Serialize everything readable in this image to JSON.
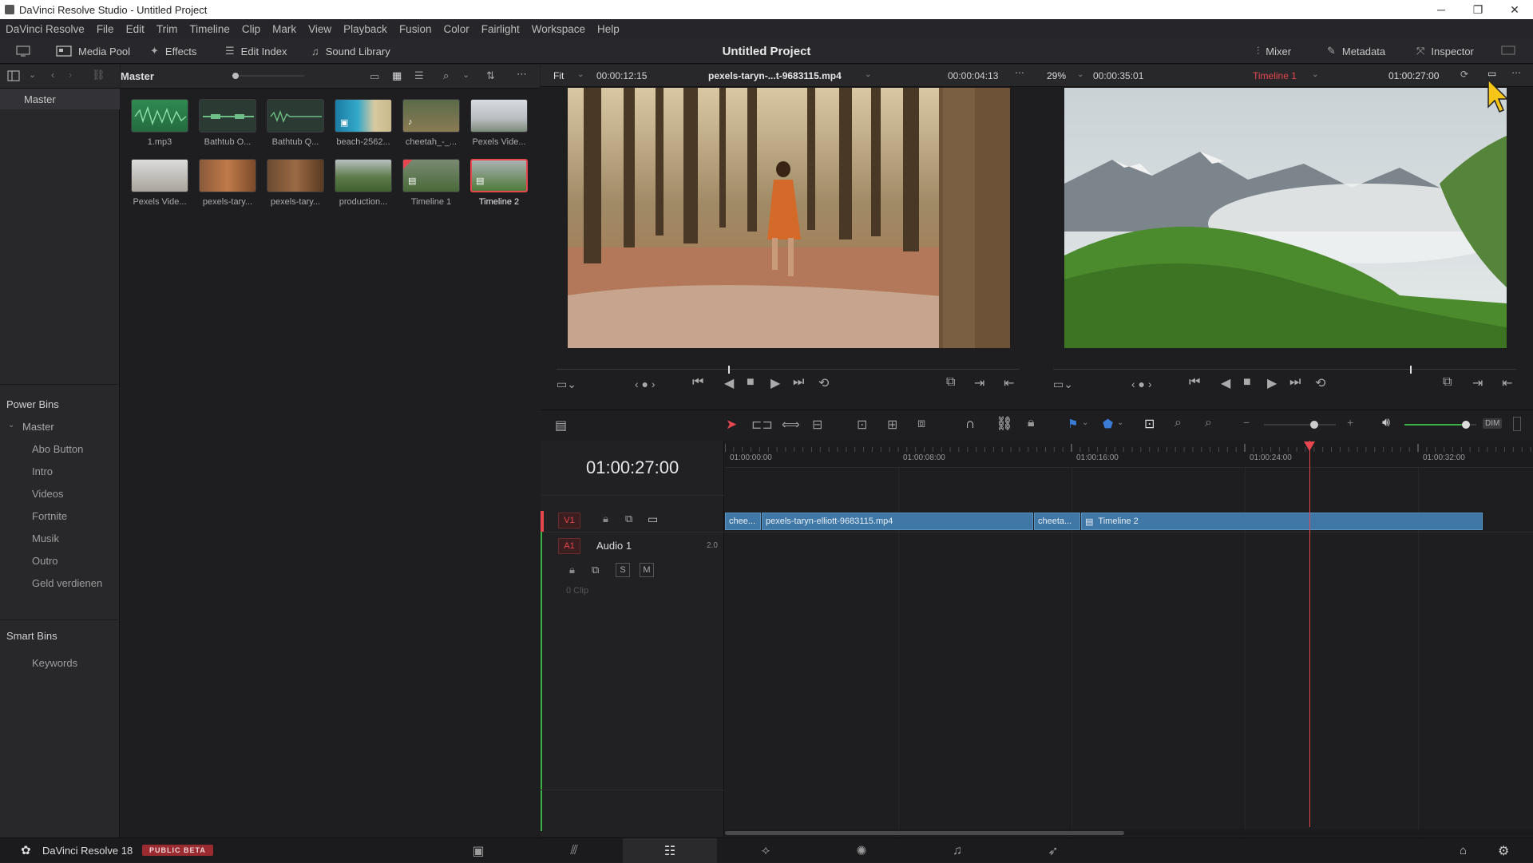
{
  "titlebar": {
    "title": "DaVinci Resolve Studio - Untitled Project",
    "minimize": "─",
    "maximize": "❐",
    "close": "✕"
  },
  "menu": [
    "DaVinci Resolve",
    "File",
    "Edit",
    "Trim",
    "Timeline",
    "Clip",
    "Mark",
    "View",
    "Playback",
    "Fusion",
    "Color",
    "Fairlight",
    "Workspace",
    "Help"
  ],
  "toolbar": {
    "media_pool": "Media Pool",
    "effects": "Effects",
    "edit_index": "Edit Index",
    "sound_library": "Sound Library",
    "project_title": "Untitled Project",
    "mixer": "Mixer",
    "metadata": "Metadata",
    "inspector": "Inspector"
  },
  "sidebar": {
    "master": "Master",
    "power_bins": "Power Bins",
    "power_master": "Master",
    "bins": [
      "Abo Button",
      "Intro",
      "Videos",
      "Fortnite",
      "Musik",
      "Outro",
      "Geld verdienen"
    ],
    "smart_bins": "Smart Bins",
    "keywords": "Keywords"
  },
  "pool": {
    "title": "Master",
    "clips_row1": [
      "1.mp3",
      "Bathtub O...",
      "Bathtub Q...",
      "beach-2562...",
      "cheetah_-_...",
      "Pexels Vide..."
    ],
    "clips_row2": [
      "Pexels Vide...",
      "pexels-tary...",
      "pexels-tary...",
      "production...",
      "Timeline 1",
      "Timeline 2"
    ]
  },
  "source_viewer": {
    "zoom": "Fit",
    "timecode_left": "00:00:12:15",
    "clip_name": "pexels-taryn-...t-9683115.mp4",
    "timecode_right": "00:00:04:13",
    "scrub_position": 0.37
  },
  "record_viewer": {
    "zoom": "29%",
    "timecode_left": "00:00:35:01",
    "timeline_name": "Timeline 1",
    "timecode_right": "01:00:27:00",
    "scrub_position": 0.77
  },
  "timeline": {
    "timecode": "01:00:27:00",
    "ruler_labels": [
      "01:00:00:00",
      "01:00:08:00",
      "01:00:16:00",
      "01:00:24:00",
      "01:00:32:00"
    ],
    "v1_label": "V1",
    "a1_label": "A1",
    "audio_name": "Audio 1",
    "audio_channels": "2.0",
    "solo": "S",
    "mute": "M",
    "clip_count": "0 Clip",
    "clips": [
      "chee...",
      "pexels-taryn-elliott-9683115.mp4",
      "cheeta...",
      "Timeline 2"
    ],
    "dim": "DIM",
    "volume_level": 0.85
  },
  "bottombar": {
    "app_name": "DaVinci Resolve 18",
    "badge": "PUBLIC BETA"
  },
  "colors": {
    "accent_red": "#e5464f",
    "clip_blue": "#3f78a6",
    "playhead": "#e5464f"
  }
}
